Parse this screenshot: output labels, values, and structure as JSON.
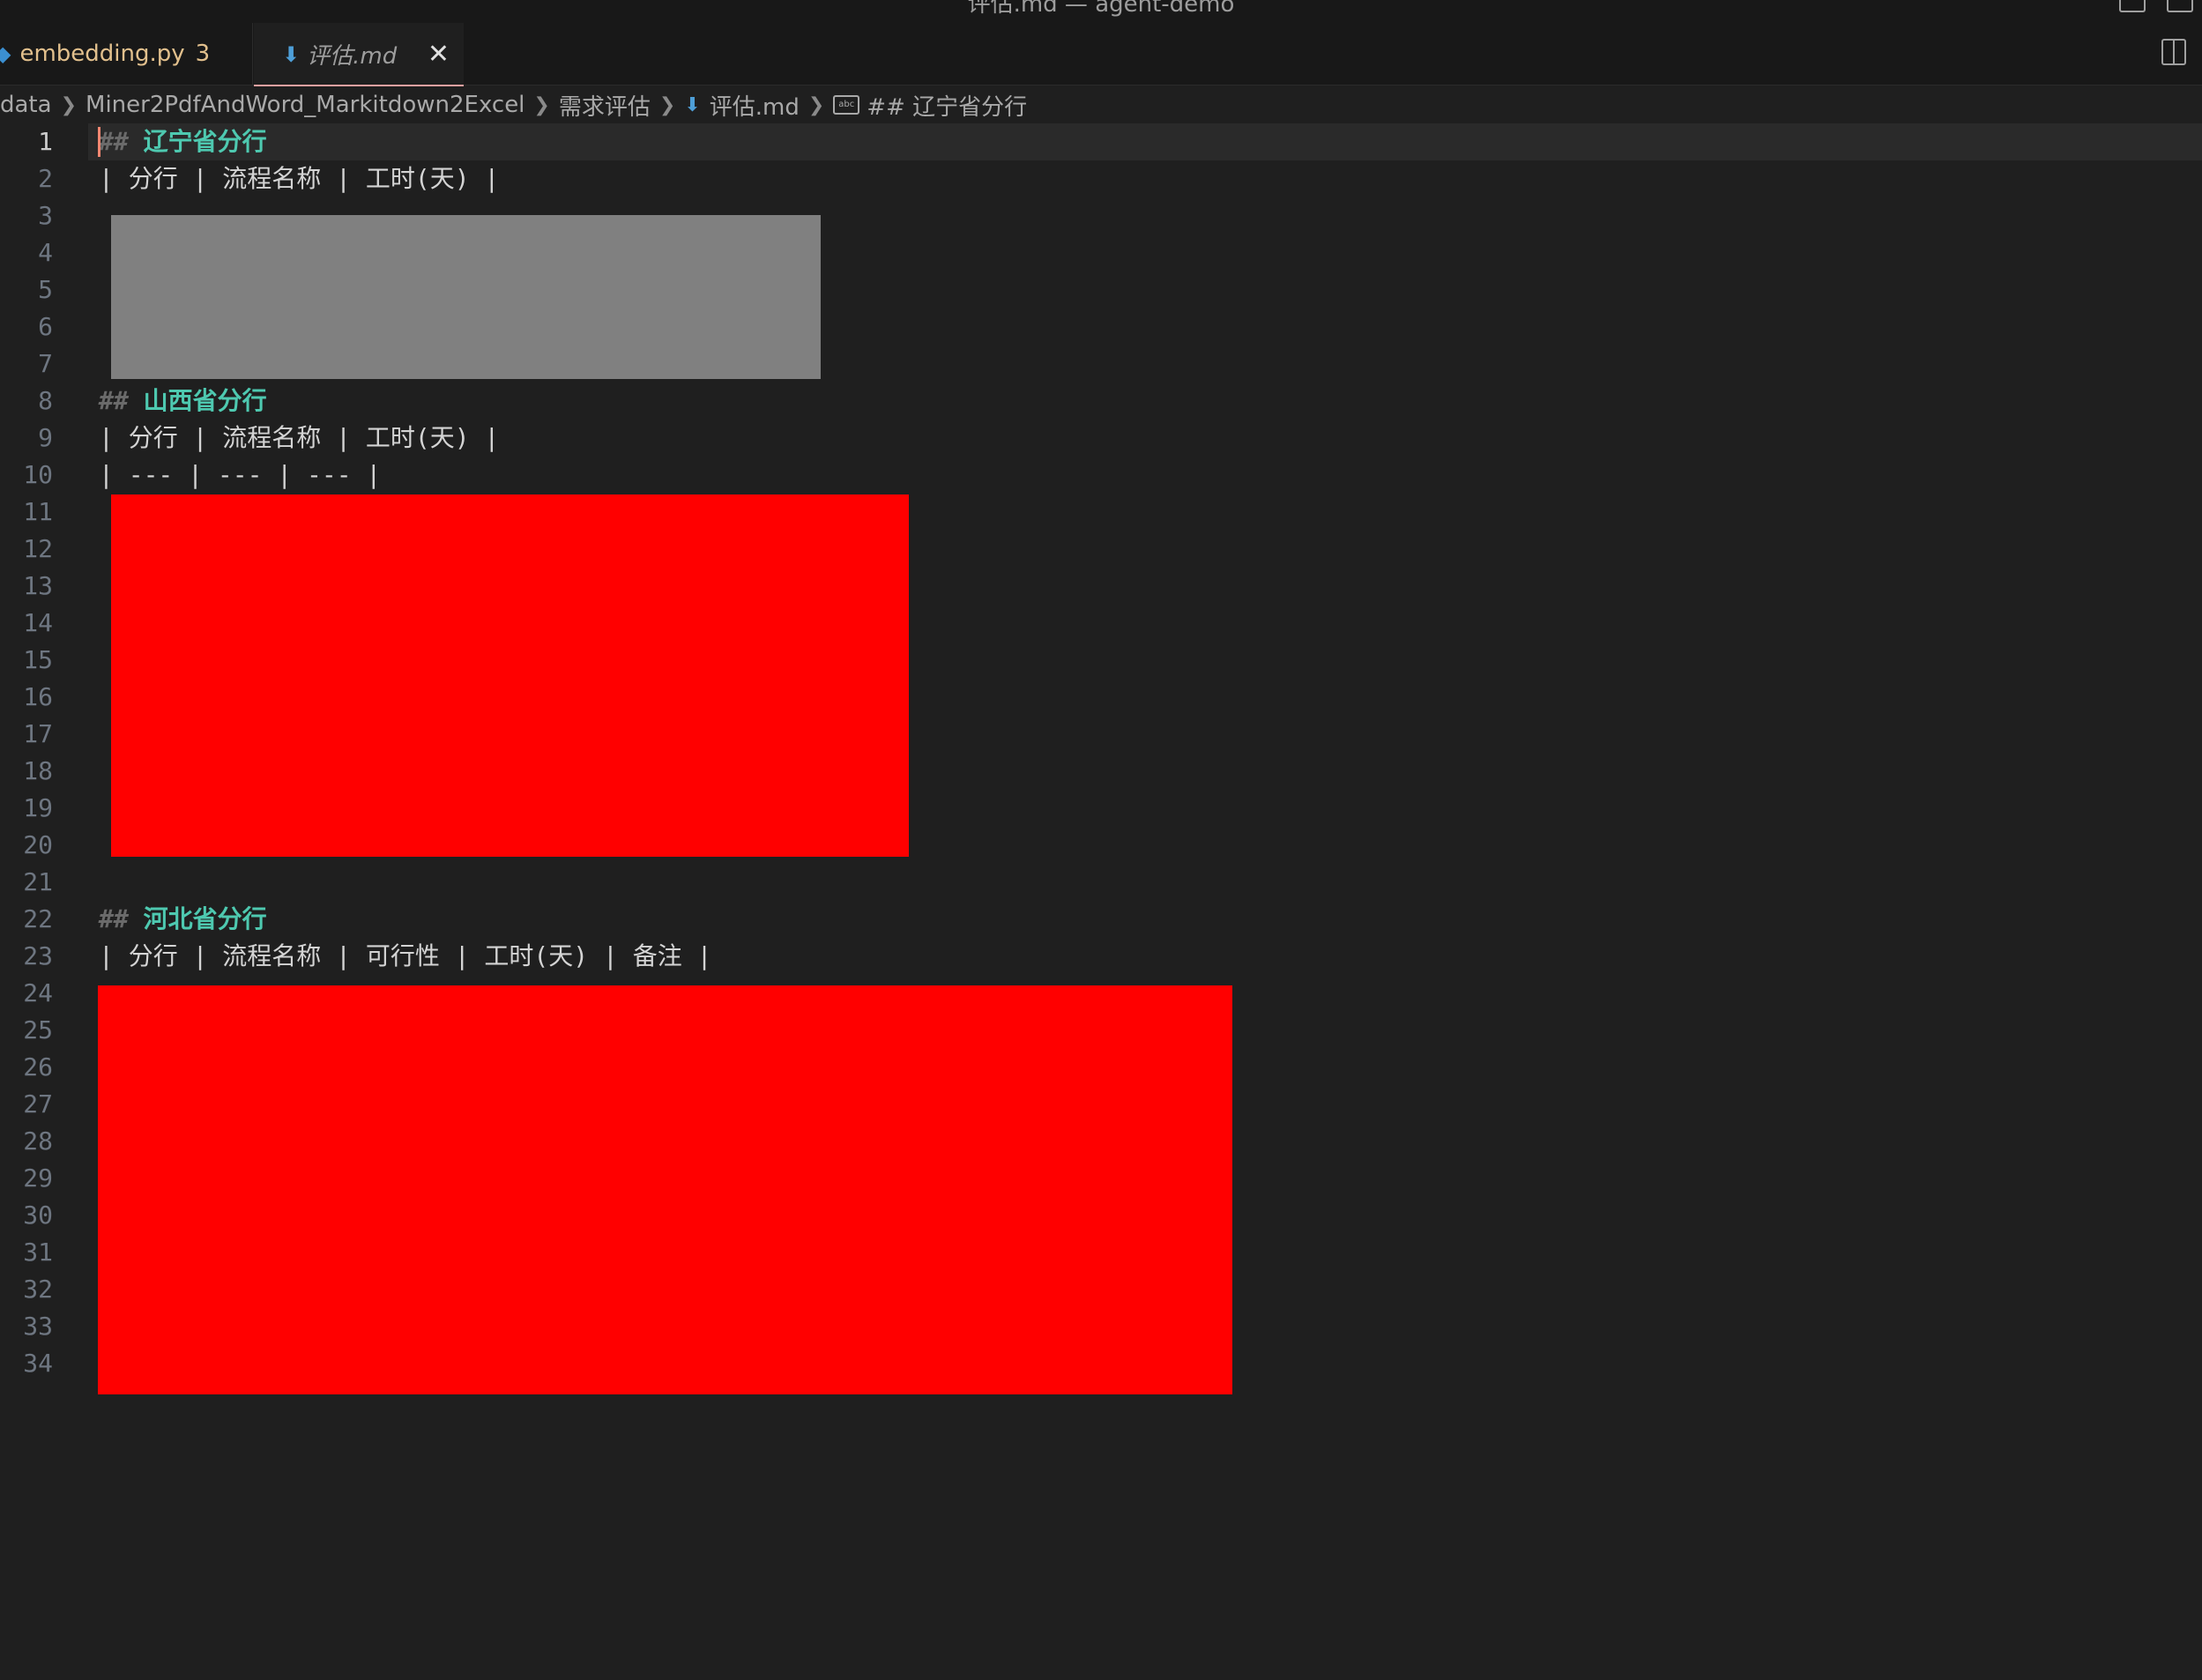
{
  "window": {
    "title": "评估.md — agent-demo"
  },
  "tabs": [
    {
      "label": "embedding.py",
      "badge": "3",
      "icon": "python-file-icon"
    },
    {
      "label": "评估.md",
      "icon": "markdown-file-icon",
      "close": "✕"
    }
  ],
  "breadcrumb": {
    "items": [
      "data",
      "Miner2PdfAndWord_Markitdown2Excel",
      "需求评估",
      "评估.md",
      "## 辽宁省分行"
    ]
  },
  "editor": {
    "line_numbers": [
      "1",
      "2",
      "3",
      "4",
      "5",
      "6",
      "7",
      "8",
      "9",
      "10",
      "11",
      "12",
      "13",
      "14",
      "15",
      "16",
      "17",
      "18",
      "19",
      "20",
      "21",
      "22",
      "23",
      "24",
      "25",
      "26",
      "27",
      "28",
      "29",
      "30",
      "31",
      "32",
      "33",
      "34"
    ],
    "current_line": "1",
    "lines": {
      "l1": {
        "hash": "##",
        "heading": "辽宁省分行"
      },
      "l2": {
        "text": "| 分行 | 流程名称 | 工时(天) |"
      },
      "l8": {
        "hash": "##",
        "heading": "山西省分行"
      },
      "l9": {
        "text": "| 分行 | 流程名称 | 工时(天) |"
      },
      "l10": {
        "text": "| --- | --- | --- |"
      },
      "l22": {
        "hash": "##",
        "heading": "河北省分行"
      },
      "l23": {
        "text": "| 分行 | 流程名称 | 可行性 | 工时(天) | 备注 |"
      }
    }
  },
  "colors": {
    "background": "#1f1f1f",
    "heading": "#4ec9b0",
    "redaction_gray": "#808080",
    "redaction_red": "#ff0000"
  }
}
